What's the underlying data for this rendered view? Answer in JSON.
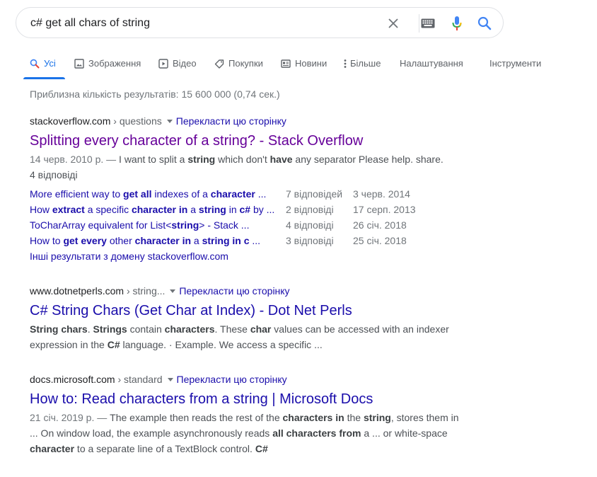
{
  "search": {
    "query": "c# get all chars of string"
  },
  "tabs": [
    {
      "label": "Усі",
      "icon": "search-icon"
    },
    {
      "label": "Зображення",
      "icon": "image-icon"
    },
    {
      "label": "Відео",
      "icon": "video-icon"
    },
    {
      "label": "Покупки",
      "icon": "tag-icon"
    },
    {
      "label": "Новини",
      "icon": "news-icon"
    },
    {
      "label": "Більше",
      "icon": "more-vert-icon"
    },
    {
      "label": "Налаштування"
    },
    {
      "label": "Інструменти"
    }
  ],
  "result_stats": "Приблизна кількість результатів: 15 600 000 (0,74 сек.)",
  "results": [
    {
      "domain": "stackoverflow.com",
      "crumb": " › questions",
      "translate": "Перекласти цю сторінку",
      "title": "Splitting every character of a string? - Stack Overflow",
      "date": "14 черв. 2010 р. — ",
      "snippet_html": "I want to split a <b>string</b> which don't <b>have</b> any separator Please help. share.",
      "answers": "4 відповіді"
    },
    {
      "domain": "www.dotnetperls.com",
      "crumb": " › string...",
      "translate": "Перекласти цю сторінку",
      "title": "C# String Chars (Get Char at Index) - Dot Net Perls",
      "snippet_html": "<b>String chars</b>. <b>Strings</b> contain <b>characters</b>. These <b>char</b> values can be accessed with an indexer expression in the <b>C#</b> language. · Example. We access a specific ..."
    },
    {
      "domain": "docs.microsoft.com",
      "crumb": " › standard",
      "translate": "Перекласти цю сторінку",
      "title": "How to: Read characters from a string | Microsoft Docs",
      "date": "21 січ. 2019 р. — ",
      "snippet_html": "The example then reads the rest of the <b>characters in</b> the <b>string</b>, stores them in ... On window load, the example asynchronously reads <b>all characters from</b> a ... or white-space <b>character</b> to a separate line of a TextBlock control. <b>C#</b>"
    }
  ],
  "sub_results": [
    {
      "title_html": "More efficient way to <b>get all</b> indexes of a <b>character</b> ...",
      "count": "7 відповідей",
      "date": "3 черв. 2014"
    },
    {
      "title_html": "How <b>extract</b> a specific <b>character in</b> a <b>string</b> in <b>c#</b> by ...",
      "count": "2 відповіді",
      "date": "17 серп. 2013"
    },
    {
      "title_html": "ToCharArray equivalent for List&lt;<b>string</b>&gt; - Stack ...",
      "count": "4 відповіді",
      "date": "26 січ. 2018"
    },
    {
      "title_html": "How to <b>get every</b> other <b>character in</b> a <b>string in c</b> ...",
      "count": "3 відповіді",
      "date": "25 січ. 2018"
    }
  ],
  "more_results": "Інші результати з домену stackoverflow.com",
  "colors": {
    "accent": "#1a73e8",
    "link": "#1a0dab",
    "visited": "#660099",
    "mic_blue": "#4285f4",
    "mic_red": "#ea4335",
    "mic_yellow": "#fbbc04",
    "mic_green": "#34a853"
  }
}
